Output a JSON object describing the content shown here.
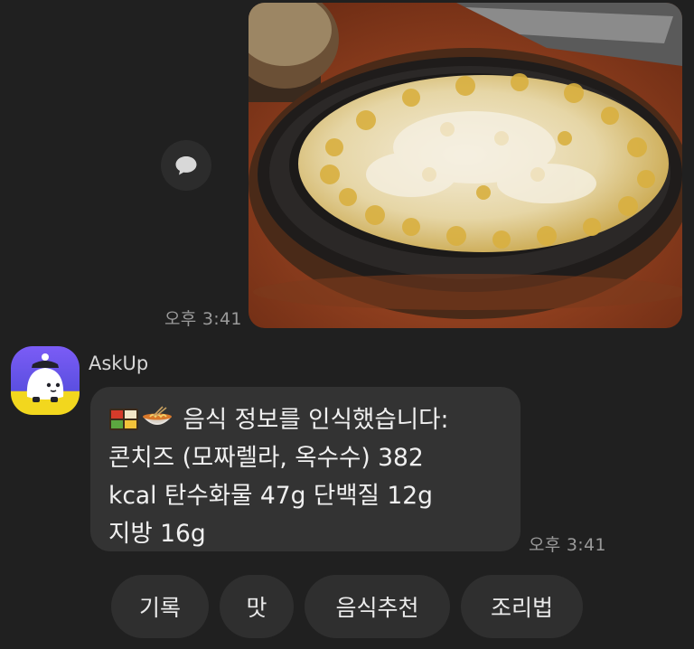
{
  "my_message": {
    "time": "오후 3:41"
  },
  "bot": {
    "sender": "AskUp",
    "message_lines": [
      "음식 정보를 인식했습니다:",
      "콘치즈 (모짜렐라, 옥수수) 382",
      "kcal 탄수화물 47g 단백질 12g",
      "지방 16g"
    ],
    "time": "오후 3:41"
  },
  "quick_replies": [
    "기록",
    "맛",
    "음식추천",
    "조리법"
  ],
  "colors": {
    "background": "#202020",
    "bubble": "#333333",
    "chip": "#2f2f2f",
    "avatar_top": "#7b5cf6",
    "avatar_bottom": "#f2d71e"
  },
  "icons": [
    "share-icon",
    "bento-emoji-icon",
    "ramen-emoji-icon",
    "askup-mascot-icon"
  ]
}
